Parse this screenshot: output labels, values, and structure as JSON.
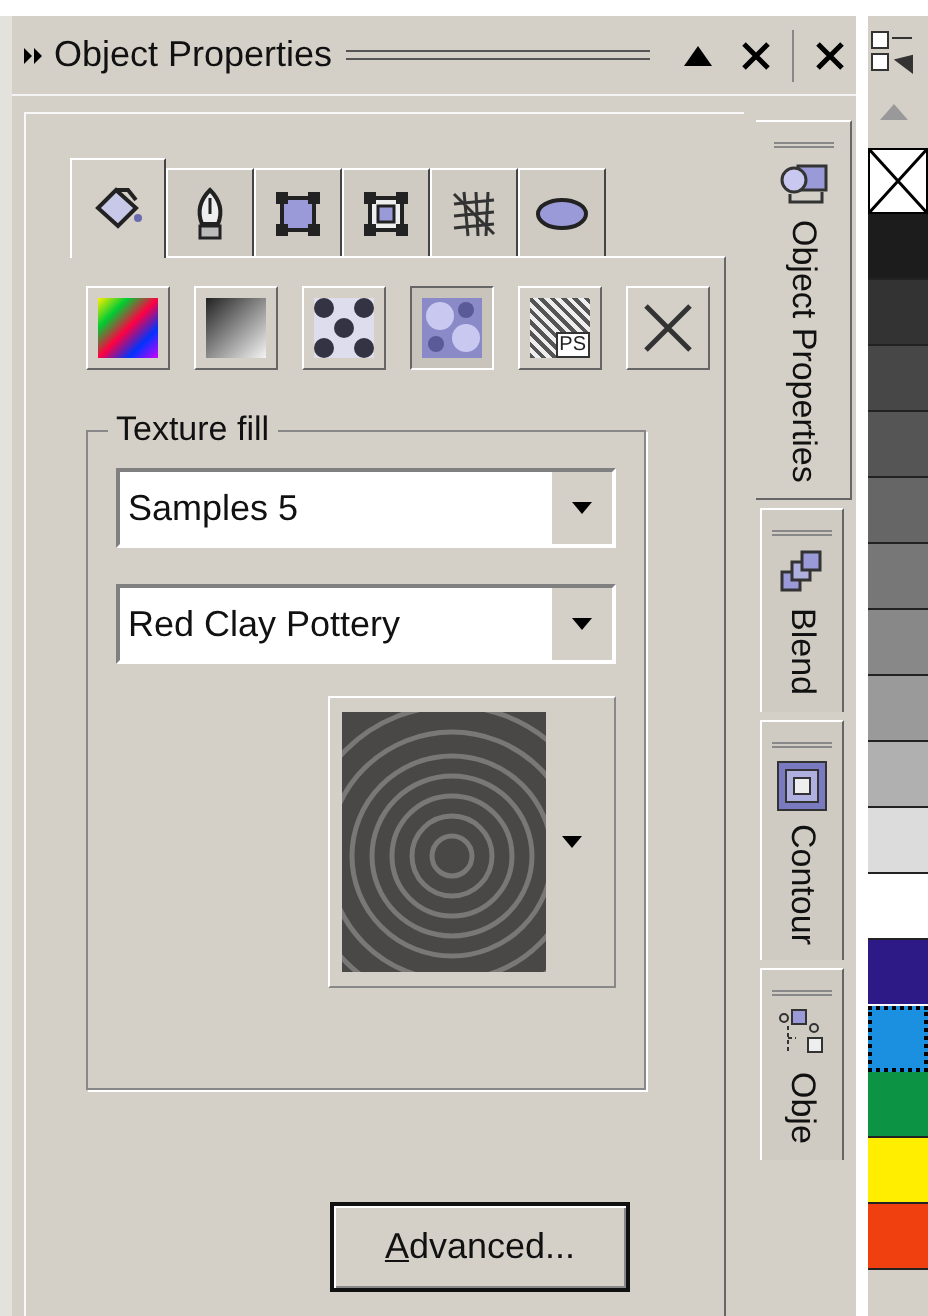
{
  "window": {
    "title": "Object Properties"
  },
  "property_tabs": [
    {
      "kind": "fill",
      "selected": true
    },
    {
      "kind": "outline",
      "selected": false
    },
    {
      "kind": "frame",
      "selected": false
    },
    {
      "kind": "frame-inner",
      "selected": false
    },
    {
      "kind": "mesh",
      "selected": false
    },
    {
      "kind": "ellipse",
      "selected": false
    }
  ],
  "fill_types": [
    {
      "kind": "uniform",
      "selected": false
    },
    {
      "kind": "fountain",
      "selected": false
    },
    {
      "kind": "pattern",
      "selected": false
    },
    {
      "kind": "texture",
      "selected": true
    },
    {
      "kind": "postscript",
      "selected": false,
      "icon_text": "PS"
    },
    {
      "kind": "none",
      "selected": false
    }
  ],
  "group": {
    "title": "Texture fill",
    "library": "Samples 5",
    "texture": "Red Clay Pottery",
    "button": "Advanced...",
    "mnemonic_underlined": true
  },
  "side_tabs": [
    {
      "label": "Object Properties",
      "kind": "properties",
      "selected": true
    },
    {
      "label": "Blend",
      "kind": "blend",
      "selected": false
    },
    {
      "label": "Contour",
      "kind": "contour",
      "selected": false
    },
    {
      "label": "Obje",
      "kind": "tree",
      "selected": false
    }
  ],
  "palette": [
    {
      "kind": "none",
      "selected": false
    },
    {
      "kind": "swatch",
      "color": "#1c1c1c",
      "selected": false
    },
    {
      "kind": "swatch",
      "color": "#333333",
      "selected": false
    },
    {
      "kind": "swatch",
      "color": "#474747",
      "selected": false
    },
    {
      "kind": "swatch",
      "color": "#555555",
      "selected": false
    },
    {
      "kind": "swatch",
      "color": "#666666",
      "selected": false
    },
    {
      "kind": "swatch",
      "color": "#777777",
      "selected": false
    },
    {
      "kind": "swatch",
      "color": "#888888",
      "selected": false
    },
    {
      "kind": "swatch",
      "color": "#9a9a9a",
      "selected": false
    },
    {
      "kind": "swatch",
      "color": "#b0b0b0",
      "selected": false
    },
    {
      "kind": "swatch",
      "color": "#dcdcdc",
      "selected": false
    },
    {
      "kind": "swatch",
      "color": "#ffffff",
      "selected": false
    },
    {
      "kind": "swatch",
      "color": "#2e1a87",
      "selected": false
    },
    {
      "kind": "swatch",
      "color": "#1b8fe0",
      "selected": true
    },
    {
      "kind": "swatch",
      "color": "#0c9344",
      "selected": false
    },
    {
      "kind": "swatch",
      "color": "#ffee00",
      "selected": false
    },
    {
      "kind": "swatch",
      "color": "#f04010",
      "selected": false
    }
  ]
}
